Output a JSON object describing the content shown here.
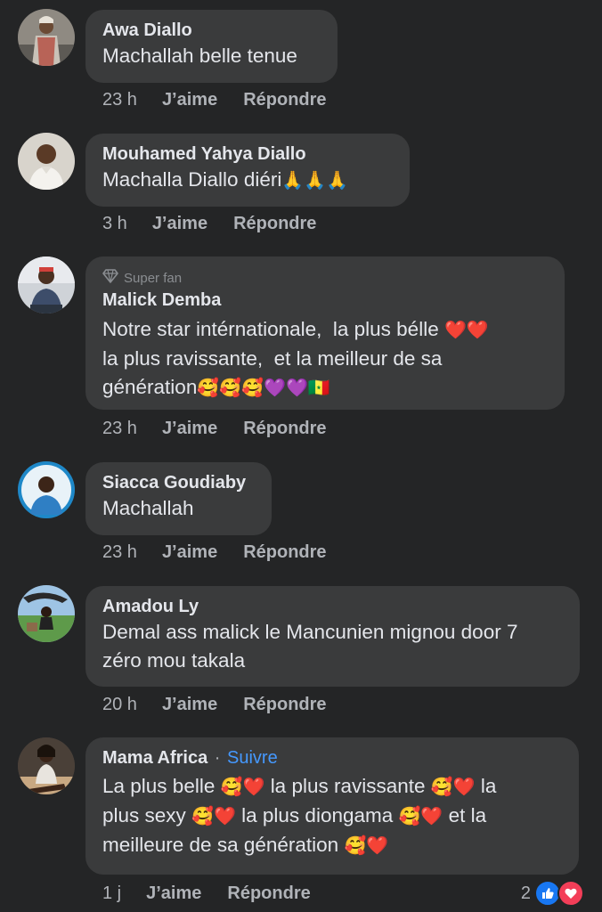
{
  "comments": [
    {
      "name": "Awa Diallo",
      "text": "Machallah belle tenue",
      "time": "23 h",
      "like": "J’aime",
      "reply": "Répondre"
    },
    {
      "name": "Mouhamed Yahya Diallo",
      "text": "Machalla Diallo diéri",
      "emoji": "🙏🙏🙏",
      "time": "3 h",
      "like": "J’aime",
      "reply": "Répondre"
    },
    {
      "badge": "Super fan",
      "name": "Malick Demba",
      "line1": "Notre star intérnationale,  la plus bélle",
      "line1_emoji": "❤️❤️",
      "line2": "la plus ravissante,  et la meilleur de sa",
      "line3": "génération",
      "line3_emoji": "🥰🥰🥰💜💜🇸🇳",
      "time": "23 h",
      "like": "J’aime",
      "reply": "Répondre"
    },
    {
      "name": "Siacca Goudiaby",
      "text": "Machallah",
      "time": "23 h",
      "like": "J’aime",
      "reply": "Répondre"
    },
    {
      "name": "Amadou Ly",
      "line1": "Demal ass malick le Mancunien mignou door 7",
      "line2": "zéro mou takala",
      "time": "20 h",
      "like": "J’aime",
      "reply": "Répondre"
    },
    {
      "name": "Mama Africa",
      "follow": "Suivre",
      "separator": "·",
      "l1a": "La plus belle",
      "l1b": "la plus ravissante",
      "l1c": "la",
      "l2a": "plus sexy",
      "l2b": "la plus diongama",
      "l2c": "et la",
      "l3a": "meilleure de sa génération",
      "emoji_pair": "🥰❤️",
      "time": "1 j",
      "like": "J’aime",
      "reply": "Répondre",
      "reaction_count": "2"
    }
  ],
  "colors": {
    "background": "#242526",
    "bubble": "#3a3b3c",
    "link": "#4599ff",
    "like_blue": "#1877f2",
    "love_red": "#f33e58"
  },
  "icons": [
    "diamond-icon",
    "like-reaction-icon",
    "love-reaction-icon"
  ]
}
